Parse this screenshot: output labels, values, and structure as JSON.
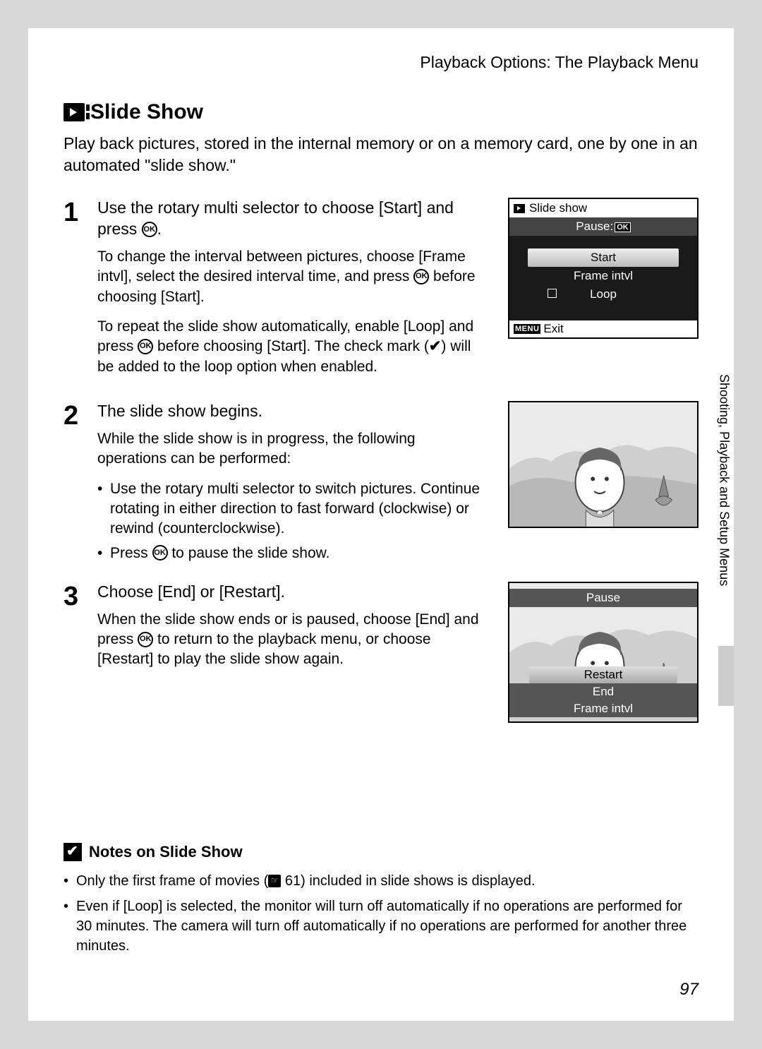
{
  "header": "Playback Options: The Playback Menu",
  "title": "Slide Show",
  "intro": "Play back pictures, stored in the internal memory or on a memory card, one by one in an automated \"slide show.\"",
  "steps": {
    "s1": {
      "num": "1",
      "title_a": "Use the rotary multi selector to choose [Start] and press ",
      "title_b": ".",
      "p1_a": "To change the interval between pictures, choose [Frame intvl], select the desired interval time, and press ",
      "p1_b": " before choosing [Start].",
      "p2_a": "To repeat the slide show automatically, enable [Loop] and press ",
      "p2_b": " before choosing [Start]. The check mark (",
      "p2_c": ") will be added to the loop option when enabled."
    },
    "s2": {
      "num": "2",
      "title": "The slide show begins.",
      "p1": "While the slide show is in progress, the following operations can be performed:",
      "b1": "Use the rotary multi selector to switch pictures. Continue rotating in either direction to fast forward (clockwise) or rewind (counterclockwise).",
      "b2_a": "Press ",
      "b2_b": " to pause the slide show."
    },
    "s3": {
      "num": "3",
      "title": "Choose [End] or [Restart].",
      "p1_a": "When the slide show ends or is paused, choose [End] and press ",
      "p1_b": " to return to the playback menu, or choose [Restart] to play the slide show again."
    }
  },
  "screen1": {
    "title": "Slide show",
    "pause": "Pause:",
    "start": "Start",
    "frame": "Frame intvl",
    "loop": "Loop",
    "exit": "Exit",
    "menu": "MENU"
  },
  "screen3": {
    "pause": "Pause",
    "restart": "Restart",
    "end": "End",
    "frame": "Frame intvl"
  },
  "notes": {
    "title": "Notes on Slide Show",
    "n1_a": "Only the first frame of movies (",
    "n1_ref": "61",
    "n1_b": ") included in slide shows is displayed.",
    "n2": "Even if [Loop] is selected, the monitor will turn off automatically if no operations are performed for 30 minutes. The camera will turn off automatically if no operations are performed for another three minutes."
  },
  "side": "Shooting, Playback and Setup Menus",
  "pagenum": "97",
  "ok_label": "OK",
  "check": "✔"
}
